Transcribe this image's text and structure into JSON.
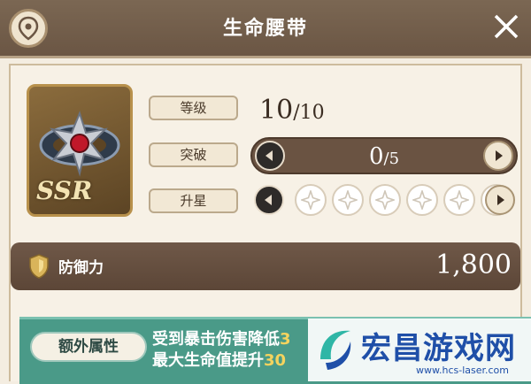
{
  "header": {
    "title": "生命腰带"
  },
  "item": {
    "rarity": "SSR"
  },
  "stats": {
    "level_label": "等级",
    "level_value": "10",
    "level_max": "/10",
    "break_label": "突破",
    "break_value": "0",
    "break_max": "/5",
    "star_label": "升星",
    "stars_filled": 0,
    "stars_total": 6
  },
  "defense": {
    "label": "防御力",
    "value": "1,800"
  },
  "extra": {
    "tag": "额外属性",
    "line1_text": "受到暴击伤害降低",
    "line1_num": "3",
    "line2_text": "最大生命值提升",
    "line2_num": "30"
  },
  "watermark": {
    "title": "宏昌游戏网",
    "url": "www.hcs-laser.com"
  },
  "colors": {
    "header_bg": "#6a5543",
    "defense_bg": "#5c4637",
    "extra_bg": "#4a9a88",
    "highlight": "#f4d35e"
  }
}
